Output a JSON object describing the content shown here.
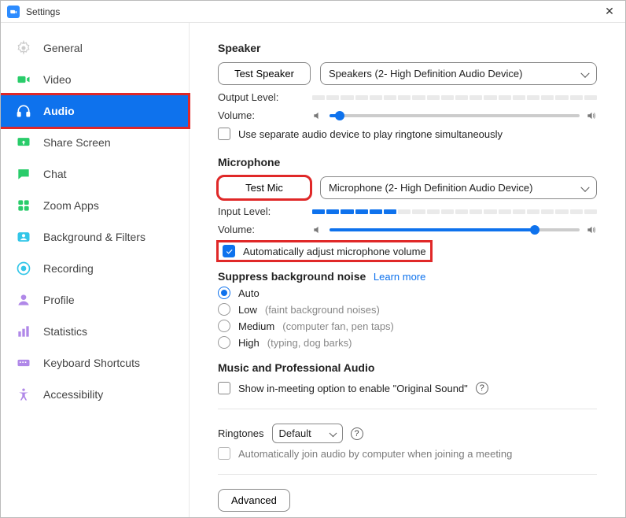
{
  "window": {
    "title": "Settings"
  },
  "sidebar": {
    "items": [
      {
        "label": "General"
      },
      {
        "label": "Video"
      },
      {
        "label": "Audio"
      },
      {
        "label": "Share Screen"
      },
      {
        "label": "Chat"
      },
      {
        "label": "Zoom Apps"
      },
      {
        "label": "Background & Filters"
      },
      {
        "label": "Recording"
      },
      {
        "label": "Profile"
      },
      {
        "label": "Statistics"
      },
      {
        "label": "Keyboard Shortcuts"
      },
      {
        "label": "Accessibility"
      }
    ],
    "active_index": 2
  },
  "speaker": {
    "heading": "Speaker",
    "test_label": "Test Speaker",
    "device": "Speakers (2- High Definition Audio Device)",
    "output_level_label": "Output Level:",
    "volume_label": "Volume:",
    "volume_percent": 4,
    "separate_device_label": "Use separate audio device to play ringtone simultaneously"
  },
  "microphone": {
    "heading": "Microphone",
    "test_label": "Test Mic",
    "device": "Microphone (2- High Definition Audio Device)",
    "input_level_label": "Input Level:",
    "input_level_percent": 32,
    "volume_label": "Volume:",
    "volume_percent": 82,
    "auto_adjust_label": "Automatically adjust microphone volume"
  },
  "suppress": {
    "heading": "Suppress background noise",
    "learn_more": "Learn more",
    "options": [
      {
        "label": "Auto",
        "hint": ""
      },
      {
        "label": "Low",
        "hint": "(faint background noises)"
      },
      {
        "label": "Medium",
        "hint": "(computer fan, pen taps)"
      },
      {
        "label": "High",
        "hint": "(typing, dog barks)"
      }
    ],
    "selected_index": 0
  },
  "music": {
    "heading": "Music and Professional Audio",
    "original_sound_label": "Show in-meeting option to enable \"Original Sound\""
  },
  "ringtones": {
    "label": "Ringtones",
    "value": "Default"
  },
  "auto_join_label": "Automatically join audio by computer when joining a meeting",
  "advanced_label": "Advanced"
}
